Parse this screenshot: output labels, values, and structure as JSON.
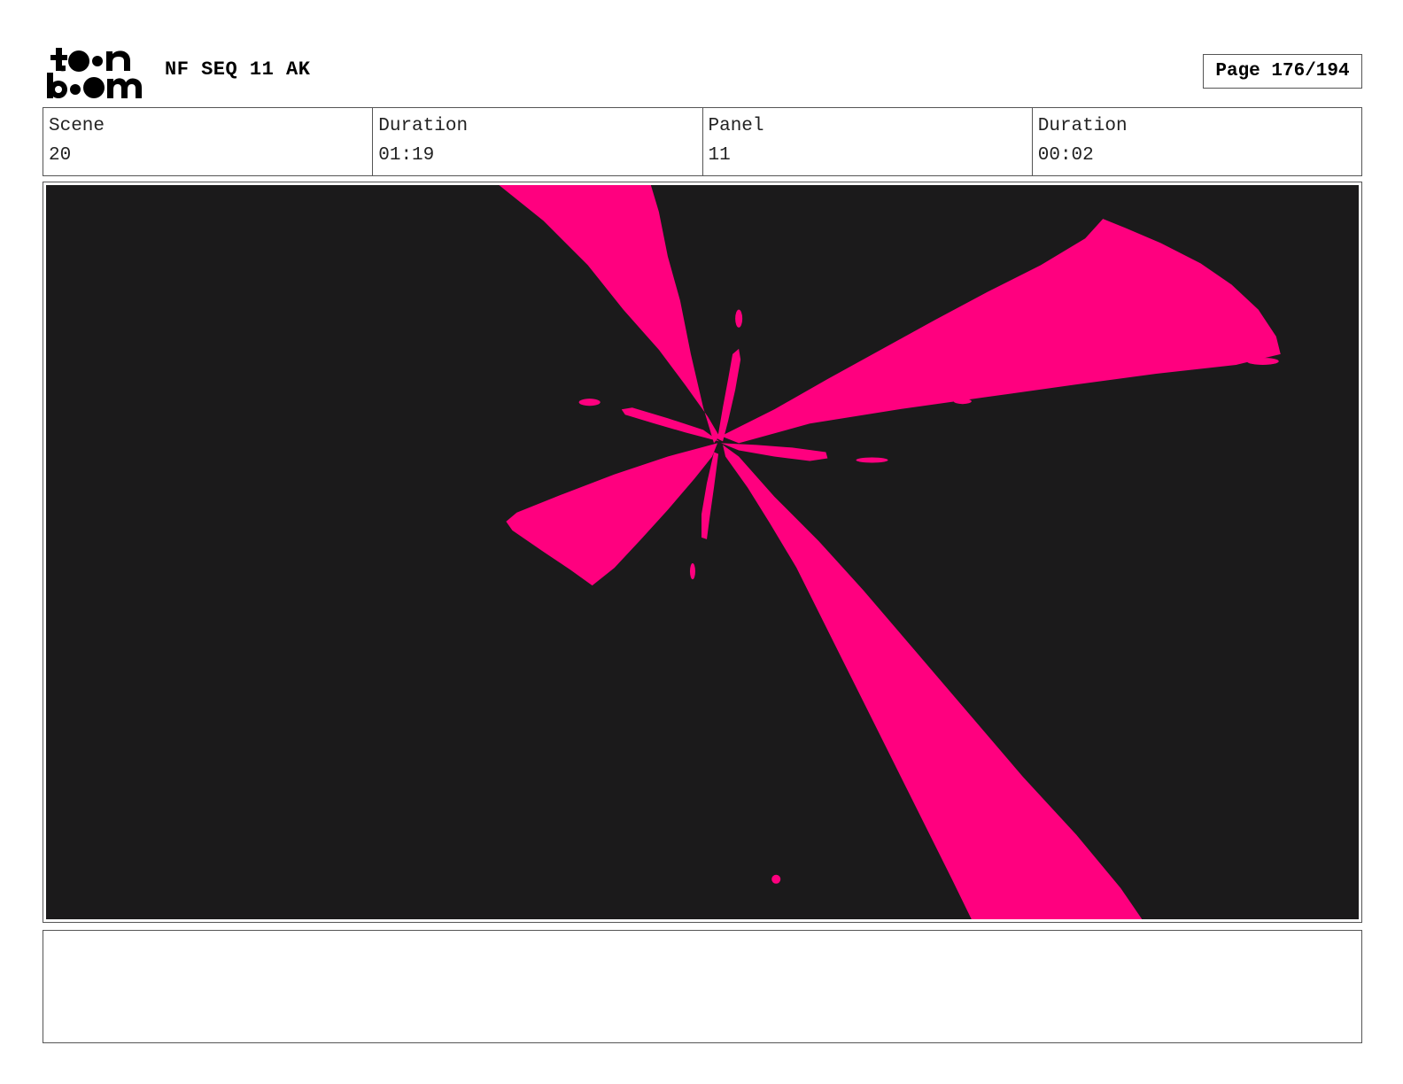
{
  "header": {
    "logo_text": "toon boom",
    "project_title": "NF SEQ 11 AK",
    "page_label": "Page 176/194"
  },
  "info": {
    "scene_label": "Scene",
    "scene_value": "20",
    "scene_duration_label": "Duration",
    "scene_duration_value": "01:19",
    "panel_label": "Panel",
    "panel_value": "11",
    "panel_duration_label": "Duration",
    "panel_duration_value": "00:02"
  },
  "panel": {
    "background_color": "#1b1a1b",
    "burst_color": "#ff007f"
  },
  "notes": {
    "text": ""
  }
}
